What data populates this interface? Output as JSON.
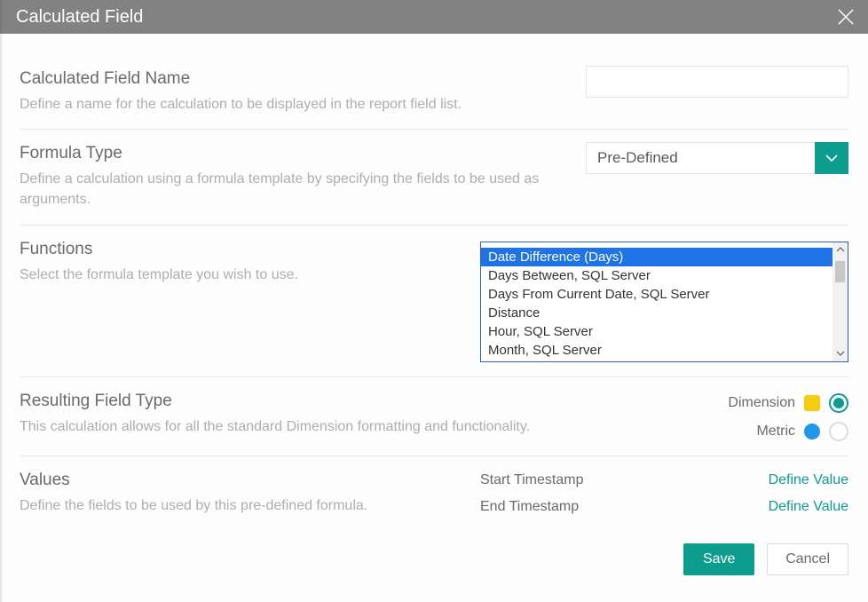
{
  "title": "Calculated Field",
  "sections": {
    "name": {
      "title": "Calculated Field Name",
      "desc": "Define a name for the calculation to be displayed in the report field list.",
      "value": ""
    },
    "formula_type": {
      "title": "Formula Type",
      "desc": "Define a calculation using a formula template by specifying the fields to be used as arguments.",
      "selected": "Pre-Defined"
    },
    "functions": {
      "title": "Functions",
      "desc": "Select the formula template you wish to use.",
      "selected_index": 1,
      "items": [
        "",
        "Date Difference (Days)",
        "Days Between, SQL Server",
        "Days From Current Date, SQL Server",
        "Distance",
        "Hour, SQL Server",
        "Month, SQL Server"
      ]
    },
    "resulting_field_type": {
      "title": "Resulting Field Type",
      "desc": "This calculation allows for all the standard Dimension formatting and functionality.",
      "dimension_label": "Dimension",
      "metric_label": "Metric",
      "selected": "dimension"
    },
    "values": {
      "title": "Values",
      "desc": "Define the fields to be used by this pre-defined formula.",
      "rows": [
        {
          "name": "Start Timestamp",
          "action": "Define Value"
        },
        {
          "name": "End Timestamp",
          "action": "Define Value"
        }
      ]
    }
  },
  "buttons": {
    "save": "Save",
    "cancel": "Cancel"
  },
  "colors": {
    "accent": "#0c9d8f",
    "list_selection": "#1e73e8",
    "dimension_swatch": "#f4cc11",
    "metric_swatch": "#1f98e8"
  }
}
